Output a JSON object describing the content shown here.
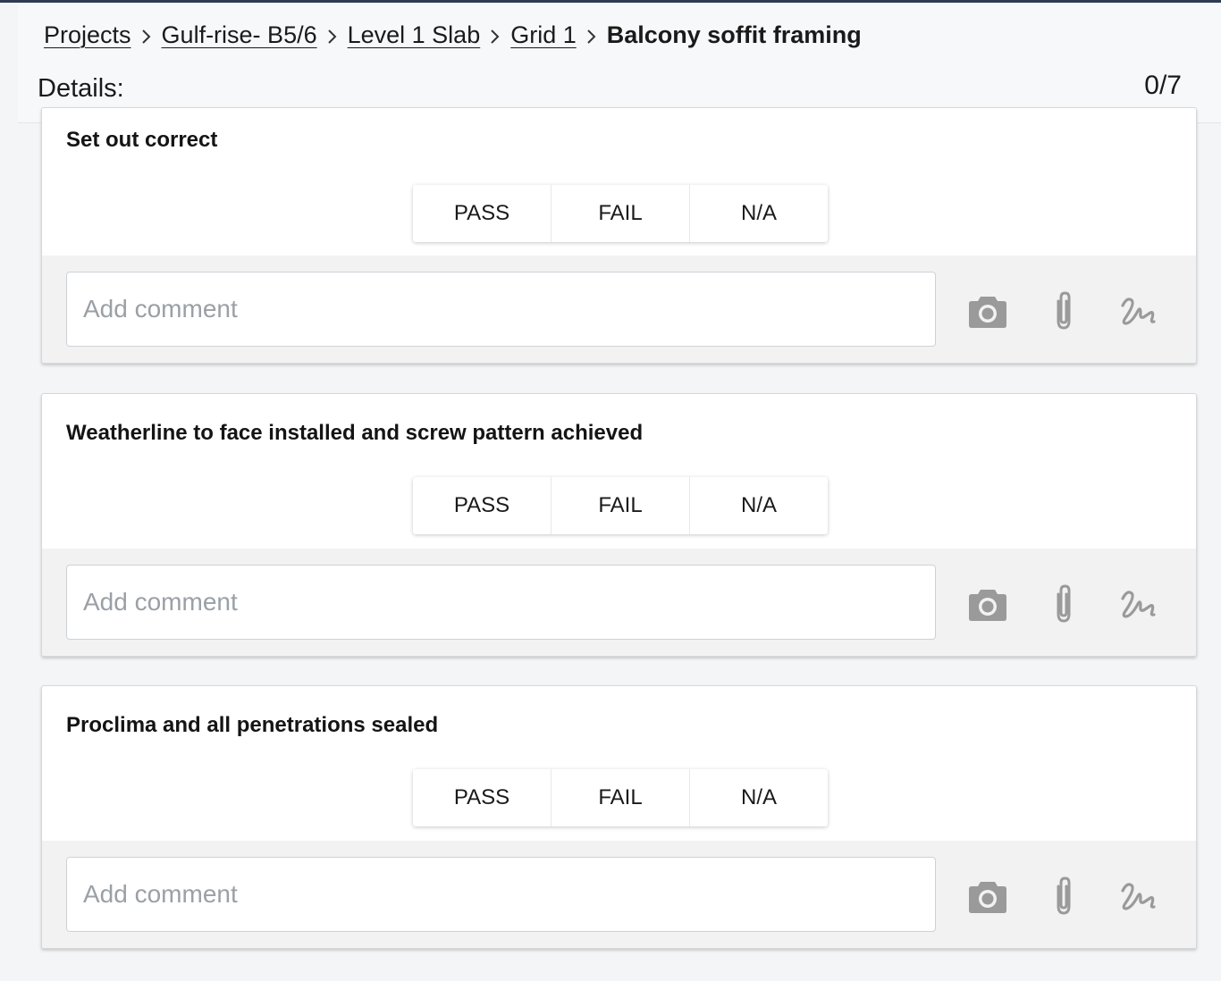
{
  "breadcrumb": {
    "items": [
      "Projects",
      "Gulf-rise- B5/6",
      "Level 1 Slab",
      "Grid 1"
    ],
    "current": "Balcony soffit framing"
  },
  "header": {
    "details_label": "Details:",
    "progress": "0/7"
  },
  "checklist": {
    "options": {
      "pass": "PASS",
      "fail": "FAIL",
      "na": "N/A"
    },
    "comment_placeholder": "Add comment",
    "items": [
      {
        "title": "Set out correct"
      },
      {
        "title": "Weatherline to face installed and screw pattern achieved"
      },
      {
        "title": "Proclima and all penetrations sealed"
      }
    ]
  },
  "icons": {
    "camera": "camera-icon",
    "attach": "paperclip-icon",
    "signature": "signature-icon",
    "chevron": "chevron-right-icon"
  },
  "colors": {
    "icon_gray": "#9a9a9a",
    "topline": "#2f3b52",
    "footer_bg": "#f2f2f2"
  }
}
